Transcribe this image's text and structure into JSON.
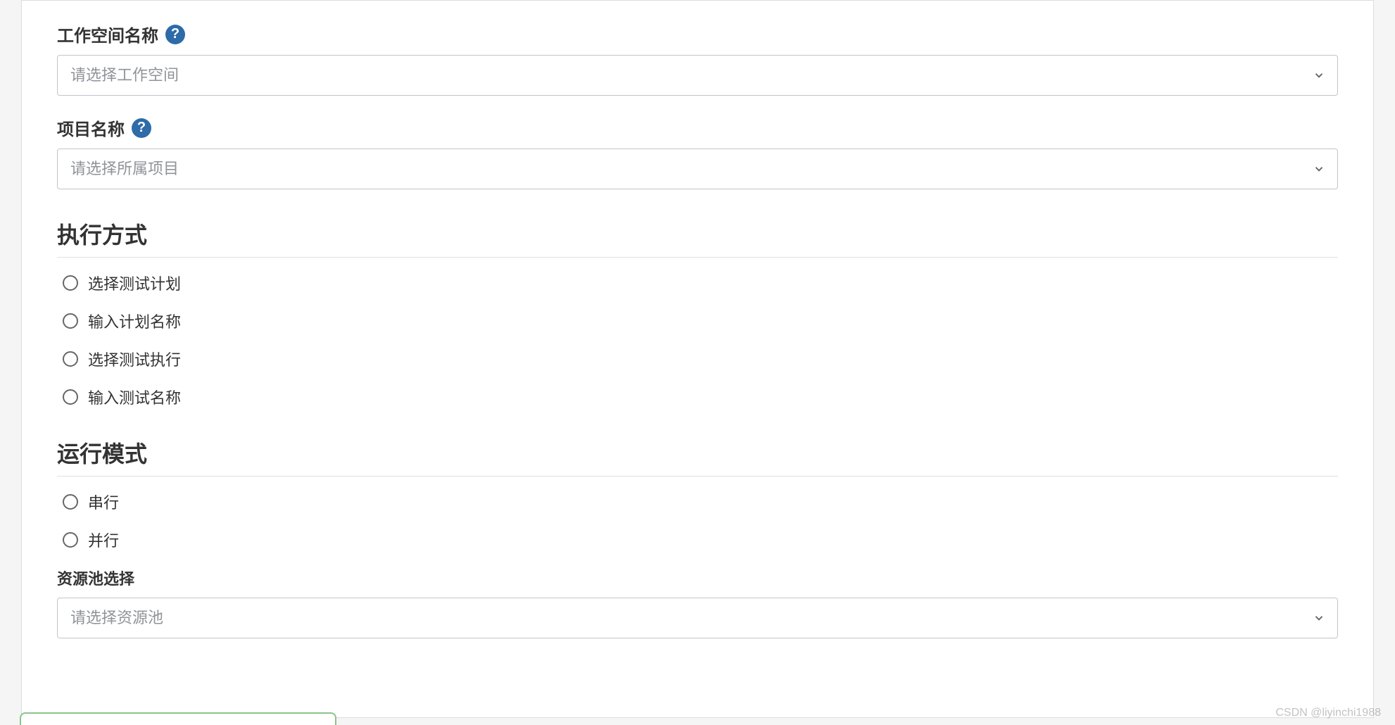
{
  "workspace": {
    "label": "工作空间名称",
    "placeholder": "请选择工作空间"
  },
  "project": {
    "label": "项目名称",
    "placeholder": "请选择所属项目"
  },
  "execution_method": {
    "heading": "执行方式",
    "options": [
      "选择测试计划",
      "输入计划名称",
      "选择测试执行",
      "输入测试名称"
    ]
  },
  "run_mode": {
    "heading": "运行模式",
    "options": [
      "串行",
      "并行"
    ]
  },
  "resource_pool": {
    "label": "资源池选择",
    "placeholder": "请选择资源池"
  },
  "watermark": "CSDN @liyinchi1988"
}
